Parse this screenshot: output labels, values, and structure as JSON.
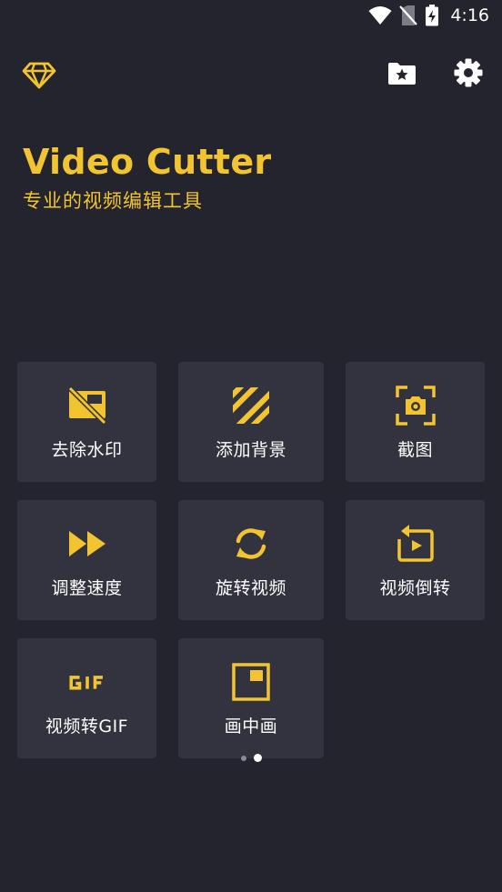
{
  "status": {
    "time": "4:16"
  },
  "hero": {
    "title": "Video Cutter",
    "subtitle": "专业的视频编辑工具"
  },
  "colors": {
    "accent": "#f2c430",
    "background": "#24242e",
    "tile": "#33333f"
  },
  "tiles": [
    {
      "label": "去除水印",
      "icon": "remove-watermark-icon"
    },
    {
      "label": "添加背景",
      "icon": "stripes-background-icon"
    },
    {
      "label": "截图",
      "icon": "screenshot-camera-icon"
    },
    {
      "label": "调整速度",
      "icon": "fast-forward-icon"
    },
    {
      "label": "旋转视频",
      "icon": "rotate-icon"
    },
    {
      "label": "视频倒转",
      "icon": "reverse-video-icon"
    },
    {
      "label": "视频转GIF",
      "icon": "gif-icon"
    },
    {
      "label": "画中画",
      "icon": "picture-in-picture-icon"
    }
  ],
  "pager": {
    "count": 2,
    "active_index": 1
  }
}
